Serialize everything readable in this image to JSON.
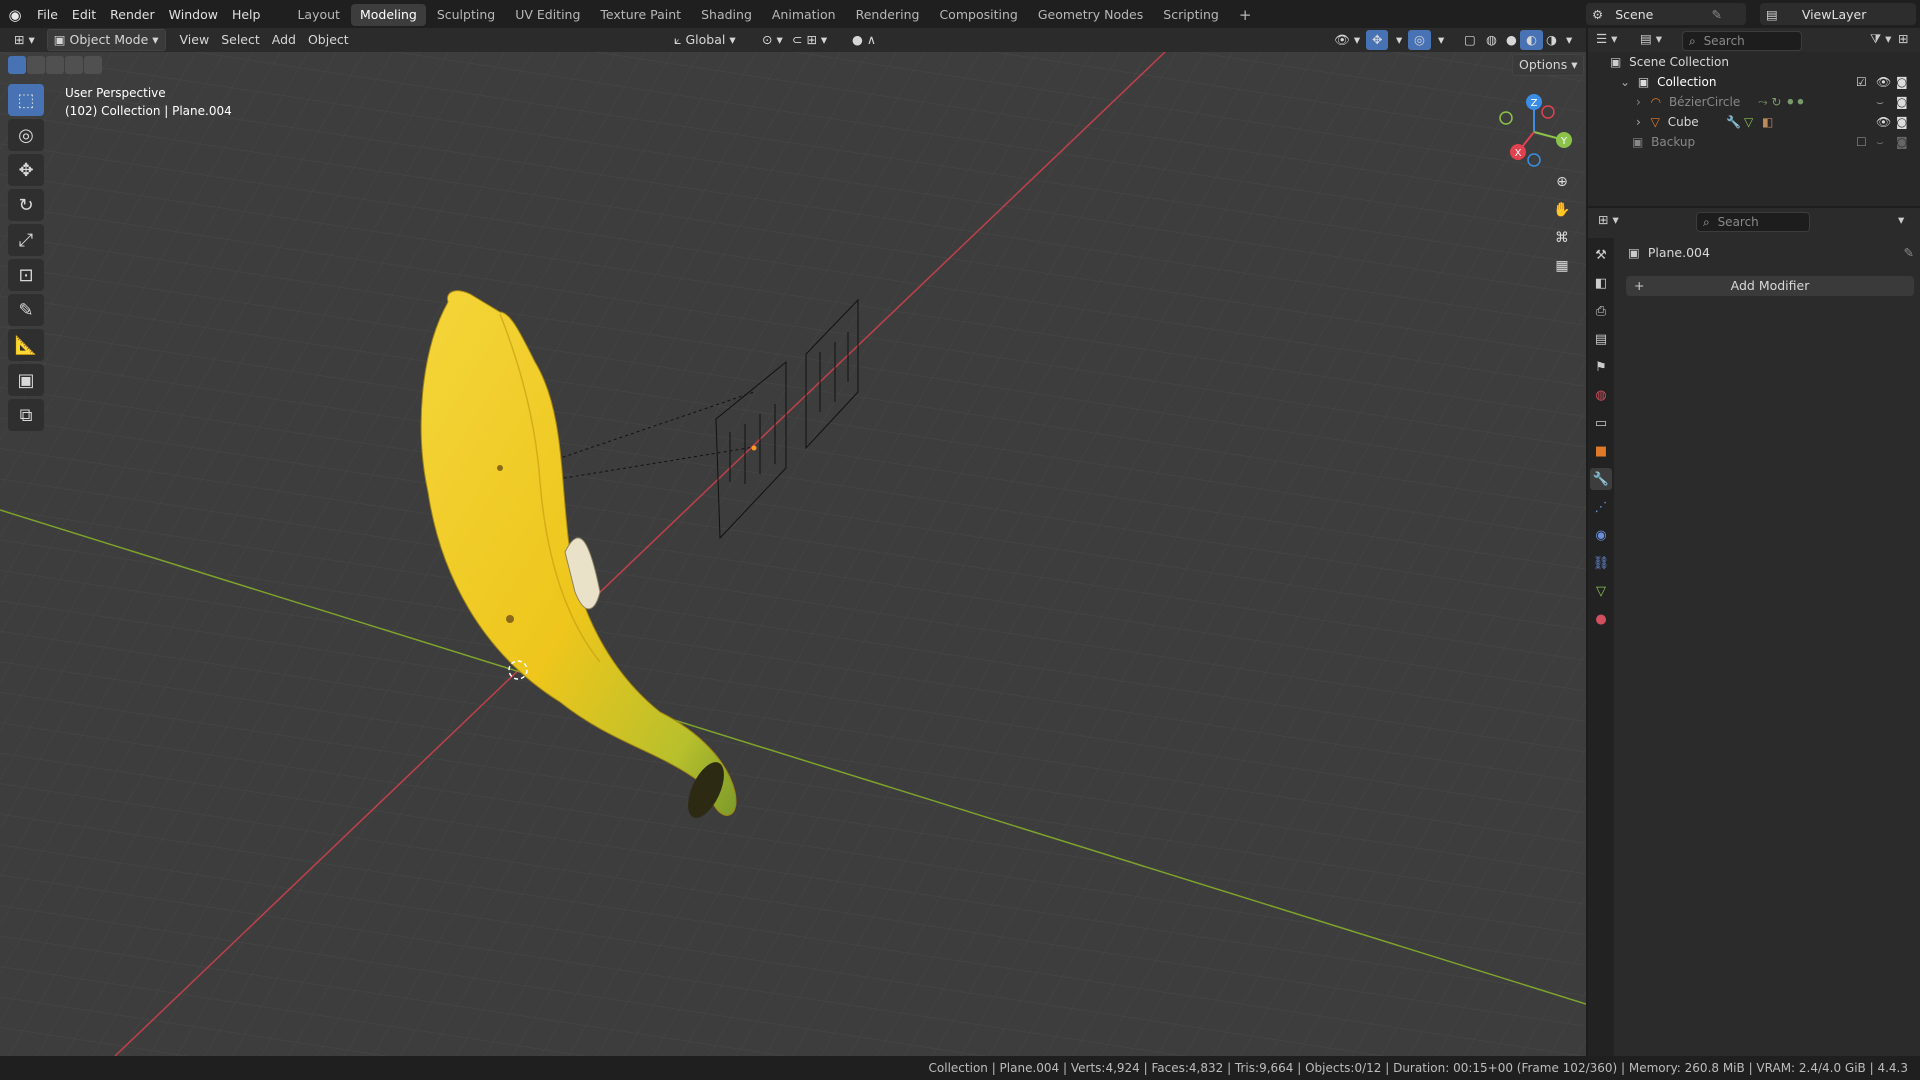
{
  "top_menu": [
    "File",
    "Edit",
    "Render",
    "Window",
    "Help"
  ],
  "workspace_tabs": [
    {
      "label": "Layout",
      "active": false
    },
    {
      "label": "Modeling",
      "active": true
    },
    {
      "label": "Sculpting",
      "active": false
    },
    {
      "label": "UV Editing",
      "active": false
    },
    {
      "label": "Texture Paint",
      "active": false
    },
    {
      "label": "Shading",
      "active": false
    },
    {
      "label": "Animation",
      "active": false
    },
    {
      "label": "Rendering",
      "active": false
    },
    {
      "label": "Compositing",
      "active": false
    },
    {
      "label": "Geometry Nodes",
      "active": false
    },
    {
      "label": "Scripting",
      "active": false
    }
  ],
  "add_workspace": "+",
  "scene": {
    "label": "Scene"
  },
  "view_layer": {
    "label": "ViewLayer"
  },
  "header": {
    "mode": "Object Mode",
    "menus": [
      "View",
      "Select",
      "Add",
      "Object"
    ],
    "transform_orientation": "Global",
    "options": "Options"
  },
  "viewport": {
    "perspective": "User Perspective",
    "context": "(102) Collection | Plane.004",
    "gizmo_axes": {
      "x": "X",
      "y": "Y",
      "z": "Z"
    }
  },
  "outliner": {
    "search_placeholder": "Search",
    "scene_collection": "Scene Collection",
    "items": [
      {
        "label": "Collection"
      },
      {
        "label": "BézierCircle"
      },
      {
        "label": "Cube"
      },
      {
        "label": "Backup"
      }
    ]
  },
  "properties": {
    "search_placeholder": "Search",
    "object_name": "Plane.004",
    "add_modifier": "Add Modifier"
  },
  "status_bar": "Collection | Plane.004 | Verts:4,924 | Faces:4,832 | Tris:9,664 | Objects:0/12 | Duration: 00:15+00 (Frame 102/360) | Memory: 260.8 MiB | VRAM: 2.4/4.0 GiB | 4.4.3",
  "colors": {
    "accent": "#4772b3",
    "x_axis": "#e0424f",
    "y_axis": "#8bc34a",
    "z_axis": "#3a8ee6",
    "banana": "#f0c419"
  }
}
